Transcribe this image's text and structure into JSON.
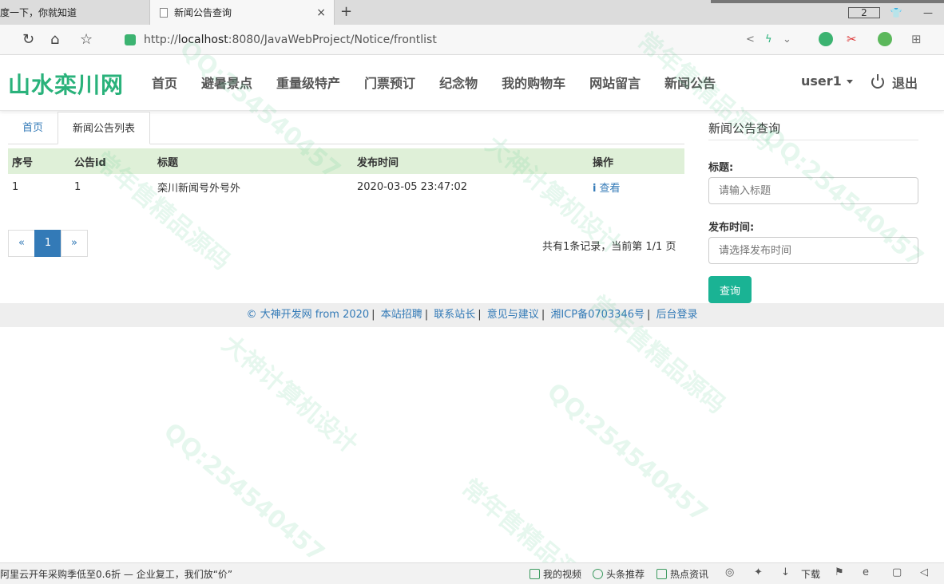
{
  "browser": {
    "tab_inactive_label": "度一下，你就知道",
    "tab_active_label": "新闻公告查询",
    "tab_close": "×",
    "new_tab": "+",
    "window_badge": "2",
    "url_prefix": "http://",
    "url_host": "localhost",
    "url_rest": ":8080/JavaWebProject/Notice/frontlist"
  },
  "site": {
    "logo": "山水栾川网",
    "menu": [
      "首页",
      "避暑景点",
      "重量级特产",
      "门票预订",
      "纪念物",
      "我的购物车",
      "网站留言",
      "新闻公告"
    ],
    "user": "user1",
    "logout": "退出"
  },
  "breadcrumb": {
    "home": "首页",
    "current": "新闻公告列表"
  },
  "table": {
    "headers": [
      "序号",
      "公告id",
      "标题",
      "发布时间",
      "操作"
    ],
    "rows": [
      {
        "index": "1",
        "id": "1",
        "title": "栾川新闻号外号外",
        "time": "2020-03-05 23:47:02",
        "action": "查看"
      }
    ]
  },
  "pager": {
    "prev": "«",
    "current": "1",
    "next": "»",
    "summary": "共有1条记录，当前第 1/1 页"
  },
  "search_panel": {
    "title": "新闻公告查询",
    "title_label": "标题:",
    "title_placeholder": "请输入标题",
    "time_label": "发布时间:",
    "time_placeholder": "请选择发布时间",
    "query_button": "查询"
  },
  "footer": {
    "links": [
      "© 大神开发网 from 2020",
      "本站招聘",
      "联系站长",
      "意见与建议",
      "湘ICP备0703346号",
      "后台登录"
    ]
  },
  "watermark": {
    "lines": [
      "QQ:254540457",
      "常年售精品源码",
      "大神计算机设计"
    ]
  },
  "statusbar": {
    "ad_text": "阿里云开年采购季低至0.6折 — 企业复工，我们放“价”",
    "my_video": "我的视频",
    "headline": "头条推荐",
    "hot_news": "热点资讯",
    "download": "下载"
  },
  "colors": {
    "brand_green": "#2ab27b",
    "link_blue": "#337ab7",
    "header_row_bg": "#dff0d8",
    "query_button_bg": "#1ab394"
  }
}
